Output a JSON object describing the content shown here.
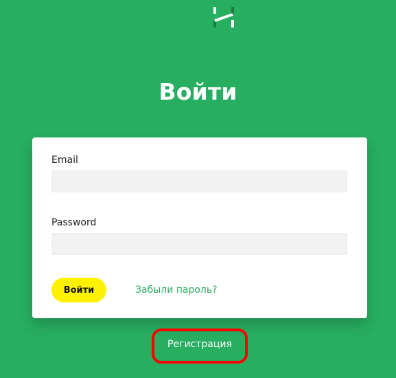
{
  "logo": {
    "icon": "h-logo-icon"
  },
  "page_title": "Войти",
  "form": {
    "email_label": "Email",
    "email_value": "",
    "password_label": "Password",
    "password_value": "",
    "submit_label": "Войти",
    "forgot_label": "Забыли пароль?"
  },
  "footer": {
    "register_label": "Регистрация"
  },
  "colors": {
    "background": "#27ae60",
    "button": "#fff200",
    "link": "#27ae60",
    "highlight": "#ff0000"
  }
}
